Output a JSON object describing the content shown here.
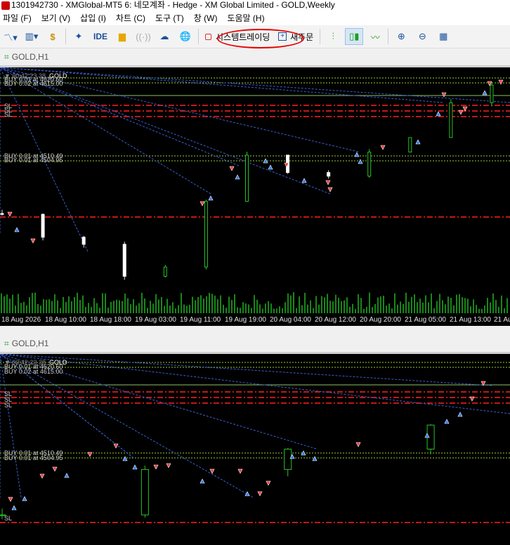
{
  "window": {
    "title": "1301942730 - XMGlobal-MT5 6: 네모계좌 - Hedge - XM Global Limited - GOLD,Weekly"
  },
  "menu": [
    "파일 (F)",
    "보기 (V)",
    "삽입 (I)",
    "차트 (C)",
    "도구 (T)",
    "창 (W)",
    "도움말 (H)"
  ],
  "toolbar": {
    "ide_label": "IDE",
    "algo_trading_label": "시스템트레이딩",
    "new_order_label": "새주문"
  },
  "colors": {
    "bull_candle": "#27c227",
    "bear_candle": "#ffffff",
    "sl_line": "#ff2020",
    "buy_line": "#9acd32",
    "trend_line": "#3a5fcd",
    "annotation": "#e80000"
  },
  "charts": [
    {
      "tab_label": "GOLD,H1",
      "symbol_label": "GOLD",
      "symbol_sub": "▼ 00:42:23.38",
      "order_labels": [
        "BUY 0.01 at 4620.60",
        "BUY 0.02 at 4615.00",
        "SL",
        "SL",
        "SL",
        "BUY 0.01 at 4510.49",
        "BUY 0.01 at 4504.95"
      ],
      "time_labels": [
        "18 Aug 2026",
        "18 Aug 10:00",
        "18 Aug 18:00",
        "19 Aug 03:00",
        "19 Aug 11:00",
        "19 Aug 19:00",
        "20 Aug 04:00",
        "20 Aug 12:00",
        "20 Aug 20:00",
        "21 Aug 05:00",
        "21 Aug 13:00",
        "21 Au"
      ]
    },
    {
      "tab_label": "GOLD,H1",
      "symbol_label": "GOLD",
      "symbol_sub": "▼ 00:42:23.38",
      "order_labels": [
        "BUY 0.01 at 4620.60",
        "BUY 0.02 at 4615.00",
        "SL",
        "SL",
        "SL",
        "BUY 0.01 at 4510.49",
        "BUY 0.01 at 4504.95",
        "SL"
      ]
    }
  ]
}
